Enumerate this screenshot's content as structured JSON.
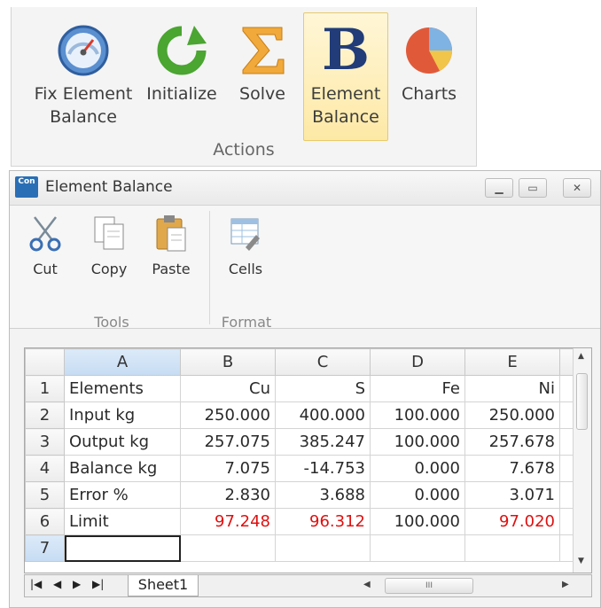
{
  "ribbon": {
    "buttons": [
      {
        "label": "Fix Element\nBalance",
        "icon": "gauge-icon"
      },
      {
        "label": "Initialize",
        "icon": "refresh-icon"
      },
      {
        "label": "Solve",
        "icon": "sigma-icon"
      },
      {
        "label": "Element\nBalance",
        "icon": "bold-b-icon",
        "active": true
      },
      {
        "label": "Charts",
        "icon": "pie-chart-icon"
      }
    ],
    "group_caption": "Actions",
    "active_color": "#fde9a6"
  },
  "window": {
    "icon_text": "Con",
    "title": "Element Balance",
    "ribbon": {
      "buttons": [
        {
          "label": "Cut",
          "icon": "scissors-icon"
        },
        {
          "label": "Copy",
          "icon": "copy-icon"
        },
        {
          "label": "Paste",
          "icon": "paste-icon"
        },
        {
          "label": "Cells",
          "icon": "cells-icon"
        }
      ],
      "groups": [
        "Tools",
        "Format"
      ]
    }
  },
  "sheet": {
    "columns": [
      "A",
      "B",
      "C",
      "D",
      "E"
    ],
    "rows": [
      {
        "num": "1",
        "cells": [
          "Elements",
          "Cu",
          "S",
          "Fe",
          "Ni"
        ]
      },
      {
        "num": "2",
        "cells": [
          "Input kg",
          "250.000",
          "400.000",
          "100.000",
          "250.000"
        ]
      },
      {
        "num": "3",
        "cells": [
          "Output kg",
          "257.075",
          "385.247",
          "100.000",
          "257.678"
        ]
      },
      {
        "num": "4",
        "cells": [
          "Balance kg",
          "7.075",
          "-14.753",
          "0.000",
          "7.678"
        ]
      },
      {
        "num": "5",
        "cells": [
          "Error %",
          "2.830",
          "3.688",
          "0.000",
          "3.071"
        ]
      },
      {
        "num": "6",
        "cells": [
          "Limit",
          "97.248",
          "96.312",
          "100.000",
          "97.020"
        ]
      },
      {
        "num": "7",
        "cells": [
          "",
          "",
          "",
          "",
          ""
        ]
      }
    ],
    "red_cells": [
      "6-1",
      "6-2",
      "6-4"
    ],
    "selected_cell": "A7",
    "tab_name": "Sheet1",
    "error_color": "#e01010"
  }
}
